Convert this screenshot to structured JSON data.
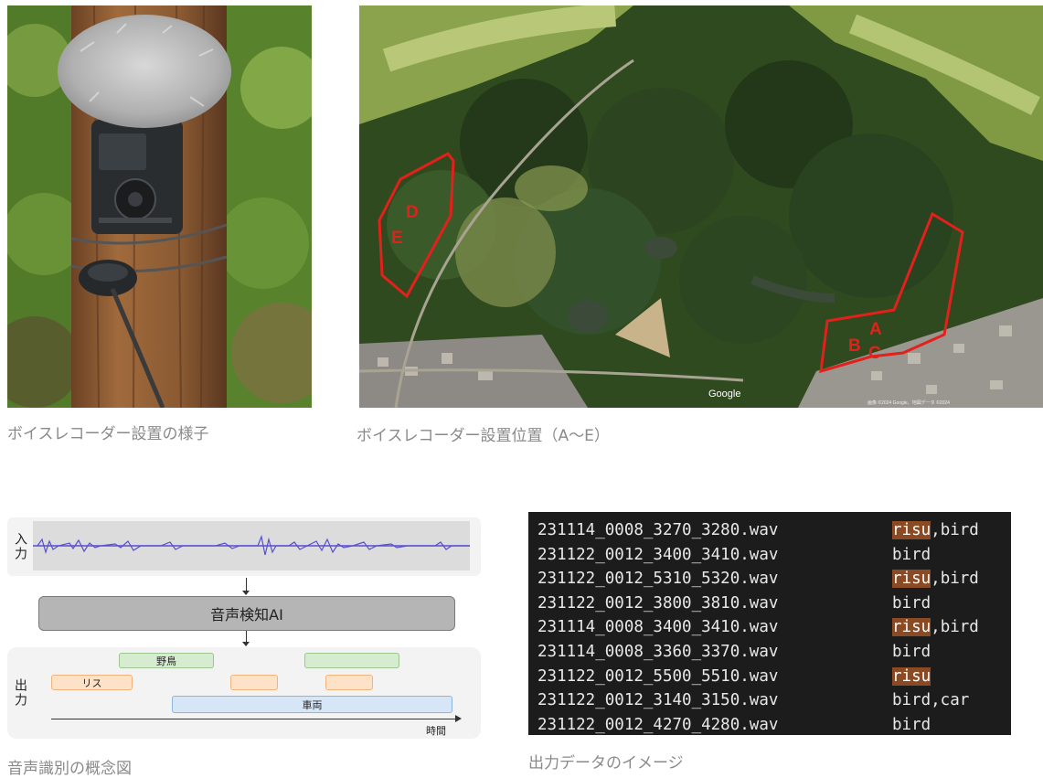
{
  "captions": {
    "photo": "ボイスレコーダー設置の様子",
    "map": "ボイスレコーダー設置位置（A〜E）",
    "diagram": "音声識別の概念図",
    "output": "出力データのイメージ"
  },
  "photo": {
    "recorder_text": "",
    "colors": {
      "bark": "#8a5a32",
      "fur": "#b9b9b9",
      "recorder": "#2a2d30",
      "foliage": "#4c7a2a"
    }
  },
  "map": {
    "markers": [
      "A",
      "B",
      "C",
      "D",
      "E"
    ],
    "google_label": "Google",
    "copyright": "画像 ©2024 Google、地図データ ©2024",
    "region_color": "#e3201b"
  },
  "diagram": {
    "input_label": "入力",
    "ai_label": "音声検知AI",
    "output_label": "出力",
    "bird_label": "野鳥",
    "risu_label": "リス",
    "car_label": "車両",
    "time_label": "時間",
    "wave_color": "#5a4fcf"
  },
  "terminal": {
    "rows": [
      {
        "file": "231114_0008_3270_3280.wav",
        "hl": "risu",
        "rest": ",bird"
      },
      {
        "file": "231122_0012_3400_3410.wav",
        "hl": "",
        "rest": "bird"
      },
      {
        "file": "231122_0012_5310_5320.wav",
        "hl": "risu",
        "rest": ",bird"
      },
      {
        "file": "231122_0012_3800_3810.wav",
        "hl": "",
        "rest": "bird"
      },
      {
        "file": "231114_0008_3400_3410.wav",
        "hl": "risu",
        "rest": ",bird"
      },
      {
        "file": "231114_0008_3360_3370.wav",
        "hl": "",
        "rest": "bird"
      },
      {
        "file": "231122_0012_5500_5510.wav",
        "hl": "risu",
        "rest": ""
      },
      {
        "file": "231122_0012_3140_3150.wav",
        "hl": "",
        "rest": "bird,car"
      },
      {
        "file": "231122_0012_4270_4280.wav",
        "hl": "",
        "rest": "bird"
      }
    ],
    "highlight_color": "#8a4a24"
  }
}
